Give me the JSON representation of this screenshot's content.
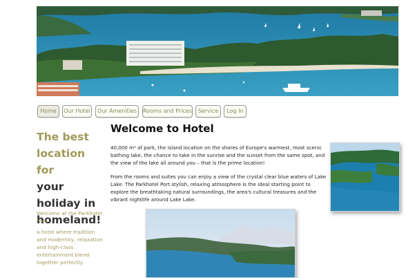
{
  "nav": {
    "items": [
      {
        "label": "Home",
        "active": true
      },
      {
        "label": "Our Hotel"
      },
      {
        "label": "Our Amenities"
      },
      {
        "label": "Rooms and Prices"
      },
      {
        "label": "Service"
      },
      {
        "label": "Log In"
      }
    ]
  },
  "sidebar": {
    "tagline_highlight": "The best location for",
    "tagline_rest": "your holiday in homeland!",
    "welcome": "Welcome at the Parkhotel Port",
    "description": "a hotel where tradition and modernity, relaxation and high-class entertainment blend together perfectly."
  },
  "main": {
    "title": "Welcome to Hotel",
    "paragraph1": "40,000 m² of park, the island location on the shores of Europe's warmest, most scenic bathing lake, the chance to take in the sunrise and the sunset from the same spot, and the view of the lake all around you – that is the prime location!",
    "paragraph2": "From the rooms and suites you can enjoy a view of the crystal clear blue waters of Lake Lake. The Parkhotel Port stylish, relaxing atmosphere is the ideal starting point to explore the breathtaking natural surroundings, the area's cultural treasures and the vibrant nightlife around Lake Lake."
  }
}
